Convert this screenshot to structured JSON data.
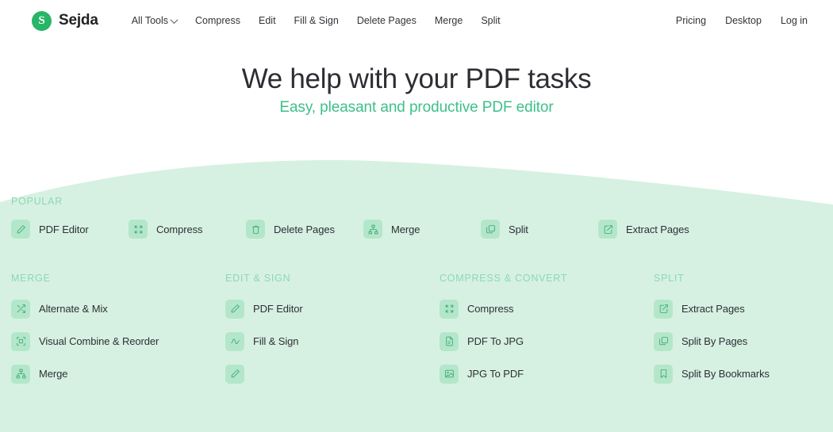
{
  "brand": {
    "mark": "S",
    "name": "Sejda",
    "logo_color": "#27b567"
  },
  "nav": {
    "main": [
      {
        "label": "All Tools",
        "has_caret": true,
        "icon": "chevron-down-icon"
      },
      {
        "label": "Compress",
        "has_caret": false
      },
      {
        "label": "Edit",
        "has_caret": false
      },
      {
        "label": "Fill & Sign",
        "has_caret": false
      },
      {
        "label": "Delete Pages",
        "has_caret": false
      },
      {
        "label": "Merge",
        "has_caret": false
      },
      {
        "label": "Split",
        "has_caret": false
      }
    ],
    "right": [
      {
        "label": "Pricing"
      },
      {
        "label": "Desktop"
      },
      {
        "label": "Log in"
      }
    ]
  },
  "hero": {
    "title": "We help with your PDF tasks",
    "subtitle": "Easy, pleasant and productive PDF editor",
    "subtitle_color": "#3ec08a"
  },
  "popular": {
    "label": "POPULAR",
    "items": [
      {
        "label": "PDF Editor",
        "icon": "pencil-icon"
      },
      {
        "label": "Compress",
        "icon": "compress-icon"
      },
      {
        "label": "Delete Pages",
        "icon": "trash-icon"
      },
      {
        "label": "Merge",
        "icon": "sitemap-icon"
      },
      {
        "label": "Split",
        "icon": "layers-icon"
      },
      {
        "label": "Extract Pages",
        "icon": "external-link-icon"
      }
    ]
  },
  "categories": [
    {
      "label": "MERGE",
      "items": [
        {
          "label": "Alternate & Mix",
          "icon": "shuffle-icon"
        },
        {
          "label": "Visual Combine & Reorder",
          "icon": "frame-icon"
        },
        {
          "label": "Merge",
          "icon": "sitemap-icon"
        }
      ]
    },
    {
      "label": "EDIT & SIGN",
      "items": [
        {
          "label": "PDF Editor",
          "icon": "pencil-icon"
        },
        {
          "label": "Fill & Sign",
          "icon": "signature-icon"
        },
        {
          "label": "",
          "icon": "pencil-icon"
        }
      ]
    },
    {
      "label": "COMPRESS & CONVERT",
      "items": [
        {
          "label": "Compress",
          "icon": "compress-icon"
        },
        {
          "label": "PDF To JPG",
          "icon": "document-icon"
        },
        {
          "label": "JPG To PDF",
          "icon": "image-icon"
        }
      ]
    },
    {
      "label": "SPLIT",
      "items": [
        {
          "label": "Extract Pages",
          "icon": "external-link-icon"
        },
        {
          "label": "Split By Pages",
          "icon": "layers-icon"
        },
        {
          "label": "Split By Bookmarks",
          "icon": "bookmark-icon"
        }
      ]
    }
  ],
  "theme": {
    "page_background": "#ffffff",
    "section_background": "#d6f1e2",
    "tile_background": "#b4e7ca",
    "icon_stroke": "#3aa777",
    "section_label_color": "#8ed8b2",
    "text_color": "#2f2f36"
  }
}
